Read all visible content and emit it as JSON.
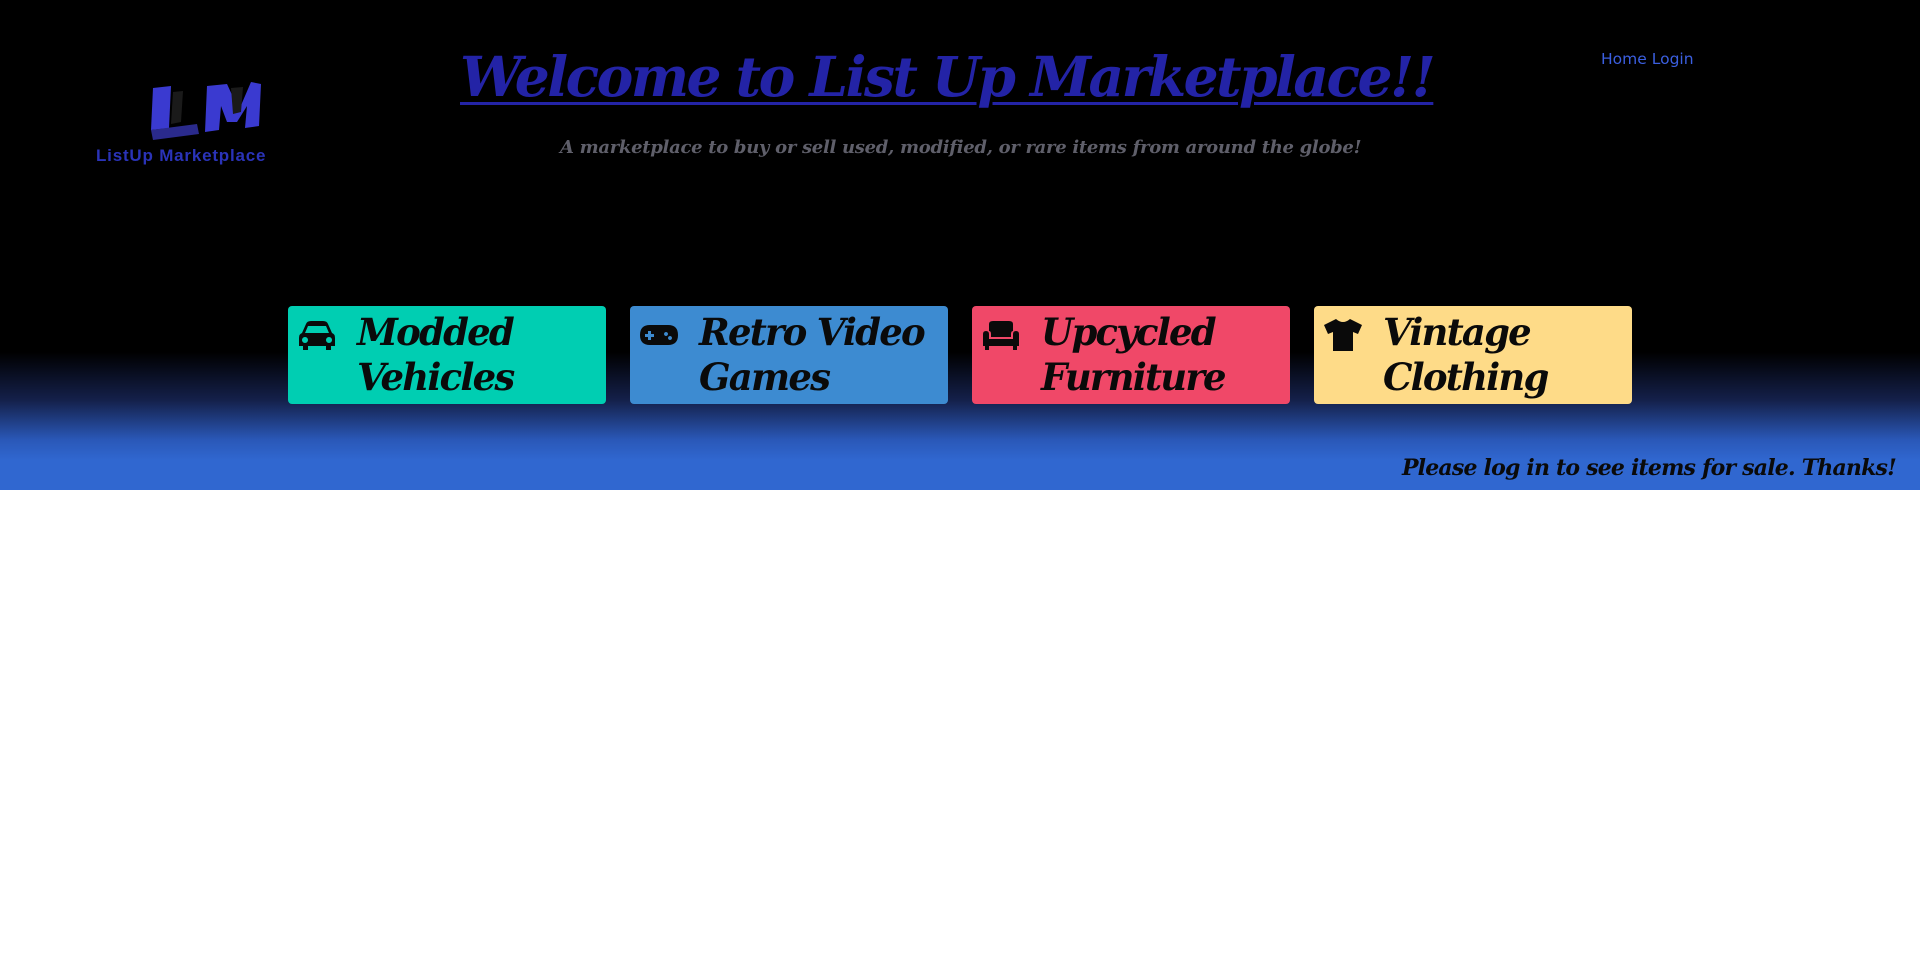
{
  "header": {
    "logo_text": "ListUp Marketplace",
    "logo_letters": "LM",
    "title": "Welcome to List Up Marketplace!!",
    "subtitle": "A marketplace to buy or sell used, modified, or rare items from around the globe!"
  },
  "nav": {
    "home_label": "Home",
    "login_label": "Login"
  },
  "categories": [
    {
      "label": "Modded Vehicles",
      "icon": "car-icon",
      "color": "#00ceb2"
    },
    {
      "label": "Retro Video Games",
      "icon": "gamepad-icon",
      "color": "#3d8bd1"
    },
    {
      "label": "Upcycled Furniture",
      "icon": "couch-icon",
      "color": "#f04868"
    },
    {
      "label": "Vintage Clothing",
      "icon": "tshirt-icon",
      "color": "#fedb88"
    }
  ],
  "notice": "Please log in to see items for sale. Thanks!",
  "colors": {
    "title": "#2323a6",
    "nav_link": "#3b5fe0",
    "band_blue": "#3067d0",
    "hero_bg": "#000000"
  }
}
